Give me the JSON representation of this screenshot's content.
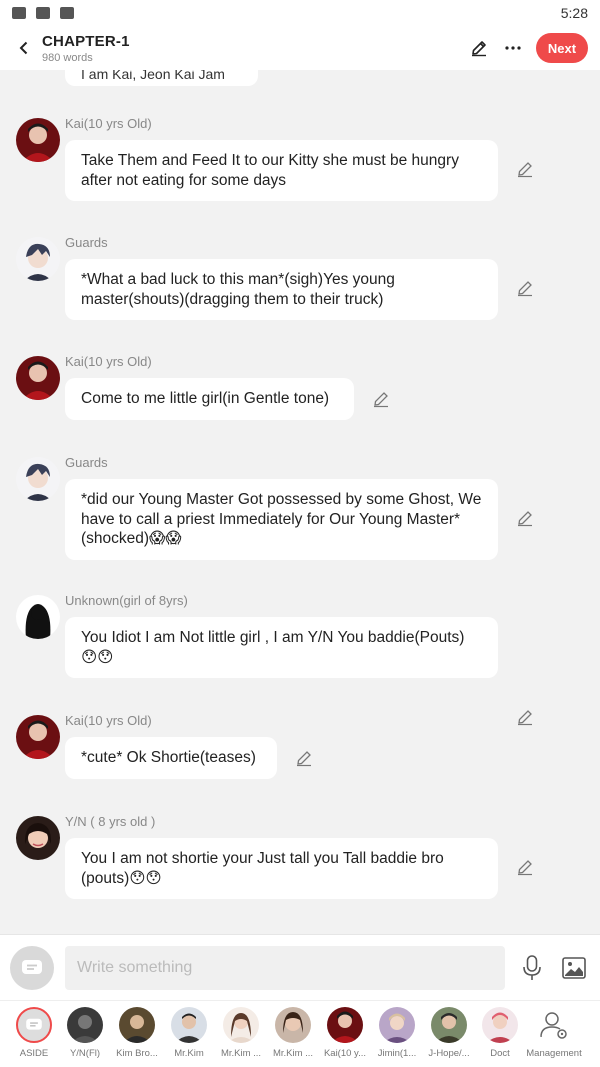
{
  "status_bar": {
    "time": "5:28"
  },
  "header": {
    "title": "CHAPTER-1",
    "word_count": "980 words",
    "next_label": "Next"
  },
  "chat": {
    "previous_bubble_text": "I am Kai, Jeon Kai Jam",
    "messages": [
      {
        "speaker": "Kai(10 yrs Old)",
        "text": "Take Them and Feed It to our Kitty she must be hungry after not eating for some days"
      },
      {
        "speaker": "Guards",
        "text": "*What a bad luck to this man*(sigh)Yes young master(shouts)(dragging them to their truck)"
      },
      {
        "speaker": "Kai(10 yrs Old)",
        "text": "Come to me little girl(in Gentle tone)"
      },
      {
        "speaker": "Guards",
        "text": "*did our Young Master Got possessed by some Ghost, We have to call a priest Immediately for Our Young Master*(shocked)😱😱"
      },
      {
        "speaker": "Unknown(girl of 8yrs)",
        "text": "You Idiot I am Not little girl , I am Y/N You baddie(Pouts) 😯😯"
      },
      {
        "speaker": "Kai(10 yrs Old)",
        "text": "*cute* Ok Shortie(teases)"
      },
      {
        "speaker": "Y/N ( 8 yrs old )",
        "text": "You I am not shortie your Just tall you Tall baddie bro (pouts)😯😯"
      }
    ]
  },
  "compose": {
    "placeholder": "Write something"
  },
  "characters": [
    {
      "name": "ASIDE"
    },
    {
      "name": "Y/N(Fl)"
    },
    {
      "name": "Kim Bro..."
    },
    {
      "name": "Mr.Kim"
    },
    {
      "name": "Mr.Kim ..."
    },
    {
      "name": "Mr.Kim ..."
    },
    {
      "name": "Kai(10 y..."
    },
    {
      "name": "Jimin(1..."
    },
    {
      "name": "J-Hope/..."
    },
    {
      "name": "Doct"
    },
    {
      "name": "Management"
    }
  ],
  "colors": {
    "accent": "#ef4a4a",
    "bubble": "#ffffff",
    "background": "#f2f2f2"
  }
}
